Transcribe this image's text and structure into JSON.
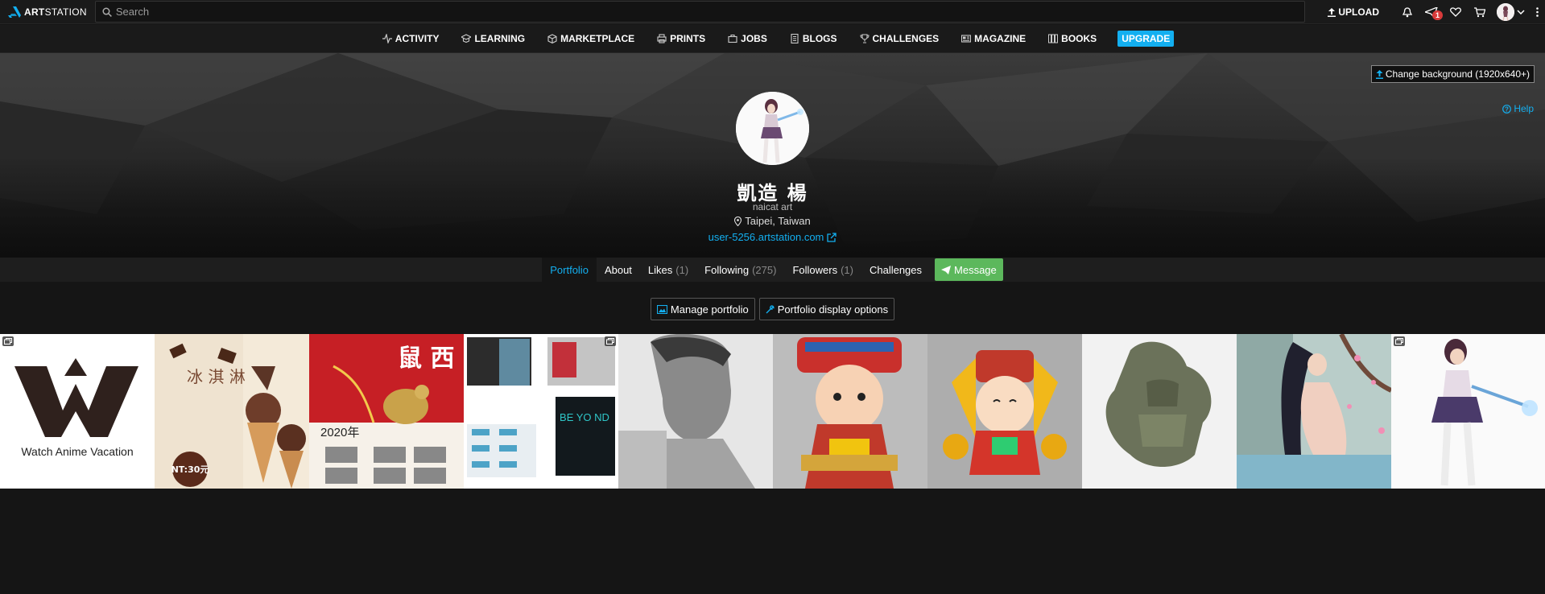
{
  "topbar": {
    "logo_bold": "ART",
    "logo_thin": "STATION",
    "search_placeholder": "Search",
    "upload_label": "UPLOAD",
    "notification_count": "1"
  },
  "nav": {
    "items": [
      {
        "label": "ACTIVITY",
        "icon": "activity-icon"
      },
      {
        "label": "LEARNING",
        "icon": "graduation-cap-icon"
      },
      {
        "label": "MARKETPLACE",
        "icon": "cube-icon"
      },
      {
        "label": "PRINTS",
        "icon": "printer-icon"
      },
      {
        "label": "JOBS",
        "icon": "briefcase-icon"
      },
      {
        "label": "BLOGS",
        "icon": "document-icon"
      },
      {
        "label": "CHALLENGES",
        "icon": "trophy-icon"
      },
      {
        "label": "MAGAZINE",
        "icon": "newspaper-icon"
      },
      {
        "label": "BOOKS",
        "icon": "books-icon"
      }
    ],
    "upgrade_label": "UPGRADE"
  },
  "hero": {
    "change_background": "Change background (1920x640+)",
    "help": "Help",
    "name": "凱造 楊",
    "headline": "naicat art",
    "location": "Taipei, Taiwan",
    "website": "user-5256.artstation.com"
  },
  "tabs": {
    "portfolio": "Portfolio",
    "about": "About",
    "likes": "Likes",
    "likes_count": "(1)",
    "following": "Following",
    "following_count": "(275)",
    "followers": "Followers",
    "followers_count": "(1)",
    "challenges": "Challenges",
    "message": "Message"
  },
  "portfolio": {
    "manage": "Manage portfolio",
    "display_options": "Portfolio display options",
    "thumb1_text": "Watch Anime Vacation",
    "thumb2_price": "NT:30元",
    "thumb2_title": "冰 淇 淋",
    "thumb3_year": "2020年",
    "thumb3_title": "鼠 西",
    "thumb4_text": "BE YO ND"
  },
  "colors": {
    "accent": "#13aff0",
    "message_green": "#5cb85c",
    "badge_red": "#d83a3a"
  }
}
